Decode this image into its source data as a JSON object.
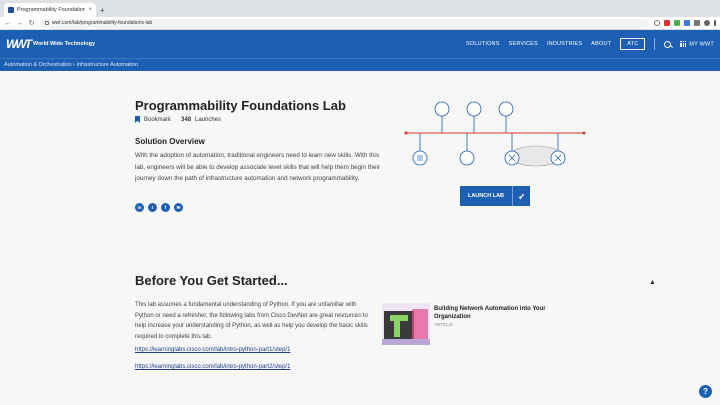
{
  "browser": {
    "tab_title": "Programmability Foundations Lab",
    "tab_close": "×",
    "new_tab": "+",
    "url": "wwt.com/lab/programmability-foundations-lab"
  },
  "site": {
    "logo_mark": "WWT",
    "logo_text": "World Wide Technology",
    "nav": [
      "SOLUTIONS",
      "SERVICES",
      "INDUSTRIES",
      "ABOUT"
    ],
    "atc_label": "ATC",
    "my_wwt": "MY WWT",
    "breadcrumb": "Automation & Orchestration  ›  Infrastructure Automation"
  },
  "lab": {
    "title": "Programmability Foundations Lab",
    "bookmark": "Bookmark",
    "separator": "·",
    "launches_count": "348",
    "launches_label": "Launches",
    "overview_title": "Solution Overview",
    "overview_body": "With the adoption of automation, traditional engineers need to learn new skills.  With this lab, engineers will be able to develop associate level skills that will help them begin their journey down the path of infrastructure automation and network programmability.",
    "launch_label": "LAUNCH LAB",
    "social": [
      "in",
      "t",
      "f",
      "✉"
    ]
  },
  "before": {
    "title": "Before You Get Started...",
    "body": "This lab assumes a fundamental understanding of Python. If you are unfamiliar with Python or need a refresher, the following labs from Cisco DevNet are great resources to help increase your understanding of Python, as well as help you develop the basic skills required to complete this lab.",
    "link1": "https://learninglabs.cisco.com/lab/intro-python-part1/step/1",
    "link2": "https://learninglabs.cisco.com/lab/intro-python-part2/step/1",
    "card_title": "Building Network Automation into Your Organization",
    "card_sub": "ARTICLE"
  },
  "help_label": "?",
  "colors": {
    "brand": "#1d5fb3",
    "accent_red": "#d9342b"
  }
}
